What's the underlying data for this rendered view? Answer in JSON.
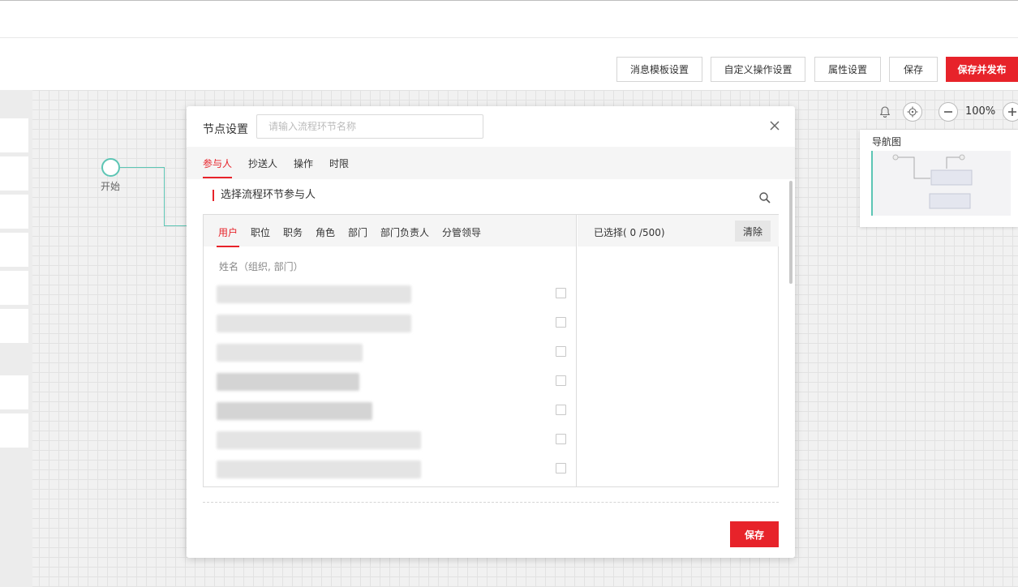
{
  "toolbar": {
    "buttons": [
      {
        "label": "消息模板设置"
      },
      {
        "label": "自定义操作设置"
      },
      {
        "label": "属性设置"
      },
      {
        "label": "保存"
      },
      {
        "label": "保存并发布"
      }
    ]
  },
  "canvas": {
    "start_node_label": "开始",
    "zoom_level": "100%",
    "navigator_title": "导航图"
  },
  "dialog": {
    "title": "节点设置",
    "name_placeholder": "请输入流程环节名称",
    "tabs": [
      {
        "label": "参与人",
        "active": true
      },
      {
        "label": "抄送人"
      },
      {
        "label": "操作"
      },
      {
        "label": "时限"
      }
    ],
    "section_title": "选择流程环节参与人",
    "picker": {
      "sub_tabs": [
        {
          "label": "用户",
          "active": true
        },
        {
          "label": "职位"
        },
        {
          "label": "职务"
        },
        {
          "label": "角色"
        },
        {
          "label": "部门"
        },
        {
          "label": "部门负责人"
        },
        {
          "label": "分管领导"
        }
      ],
      "list_header": "姓名（组织, 部门）",
      "selected_label": "已选择( 0 /500)",
      "clear_label": "清除",
      "user_rows_count": 7
    },
    "save_label": "保存"
  },
  "colors": {
    "accent": "#e7232a",
    "edge": "#5cc5b4"
  }
}
